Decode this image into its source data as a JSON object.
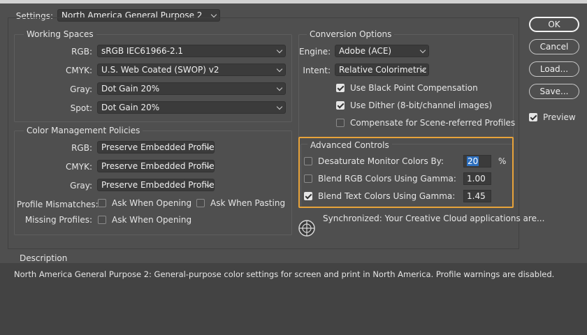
{
  "settings": {
    "label": "Settings:",
    "value": "North America General Purpose 2"
  },
  "working_spaces": {
    "title": "Working Spaces",
    "rgb": {
      "label": "RGB:",
      "value": "sRGB IEC61966-2.1"
    },
    "cmyk": {
      "label": "CMYK:",
      "value": "U.S. Web Coated (SWOP) v2"
    },
    "gray": {
      "label": "Gray:",
      "value": "Dot Gain 20%"
    },
    "spot": {
      "label": "Spot:",
      "value": "Dot Gain 20%"
    }
  },
  "policies": {
    "title": "Color Management Policies",
    "rgb": {
      "label": "RGB:",
      "value": "Preserve Embedded Profiles"
    },
    "cmyk": {
      "label": "CMYK:",
      "value": "Preserve Embedded Profiles"
    },
    "gray": {
      "label": "Gray:",
      "value": "Preserve Embedded Profiles"
    },
    "mismatches_label": "Profile Mismatches:",
    "ask_opening": "Ask When Opening",
    "ask_pasting": "Ask When Pasting",
    "missing_label": "Missing Profiles:",
    "missing_ask_opening": "Ask When Opening"
  },
  "conversion": {
    "title": "Conversion Options",
    "engine": {
      "label": "Engine:",
      "value": "Adobe (ACE)"
    },
    "intent": {
      "label": "Intent:",
      "value": "Relative Colorimetric"
    },
    "black_point": "Use Black Point Compensation",
    "dither": "Use Dither (8-bit/channel images)",
    "scene_referred": "Compensate for Scene-referred Profiles"
  },
  "advanced": {
    "title": "Advanced Controls",
    "desaturate": {
      "label": "Desaturate Monitor Colors By:",
      "value": "20",
      "unit": "%"
    },
    "blend_rgb": {
      "label": "Blend RGB Colors Using Gamma:",
      "value": "1.00"
    },
    "blend_text": {
      "label": "Blend Text Colors Using Gamma:",
      "value": "1.45"
    }
  },
  "sync": {
    "text": "Synchronized: Your Creative Cloud applications are..."
  },
  "description": {
    "title": "Description",
    "text": "North America General Purpose 2:  General-purpose color settings for screen and print in North America. Profile warnings are disabled."
  },
  "buttons": {
    "ok": "OK",
    "cancel": "Cancel",
    "load": "Load...",
    "save": "Save...",
    "preview": "Preview"
  },
  "colors": {
    "highlight": "#e8a33a",
    "selection": "#2c6fbf"
  }
}
